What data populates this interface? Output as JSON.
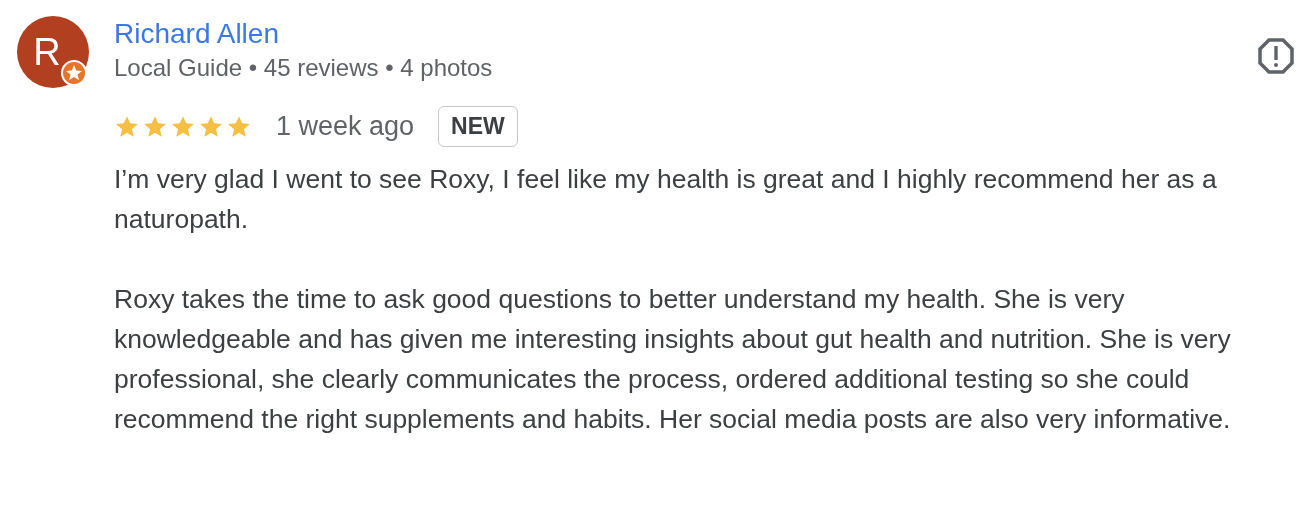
{
  "review": {
    "avatar_letter": "R",
    "local_guide_badge": true,
    "name": "Richard Allen",
    "meta": "Local Guide • 45 reviews • 4 photos",
    "stars": 5,
    "time": "1 week ago",
    "badge": "NEW",
    "paragraphs": [
      "I’m very glad I went to see Roxy, I feel like my health is great and I highly recommend her as a naturopath.",
      "Roxy takes the time to ask good questions to better understand my health. She is very knowledgeable and has given me interesting insights about gut health and nutrition. She is very professional, she clearly communicates the process, ordered additional testing so she could recommend the right supplements and habits. Her social media posts are also very informative."
    ]
  }
}
